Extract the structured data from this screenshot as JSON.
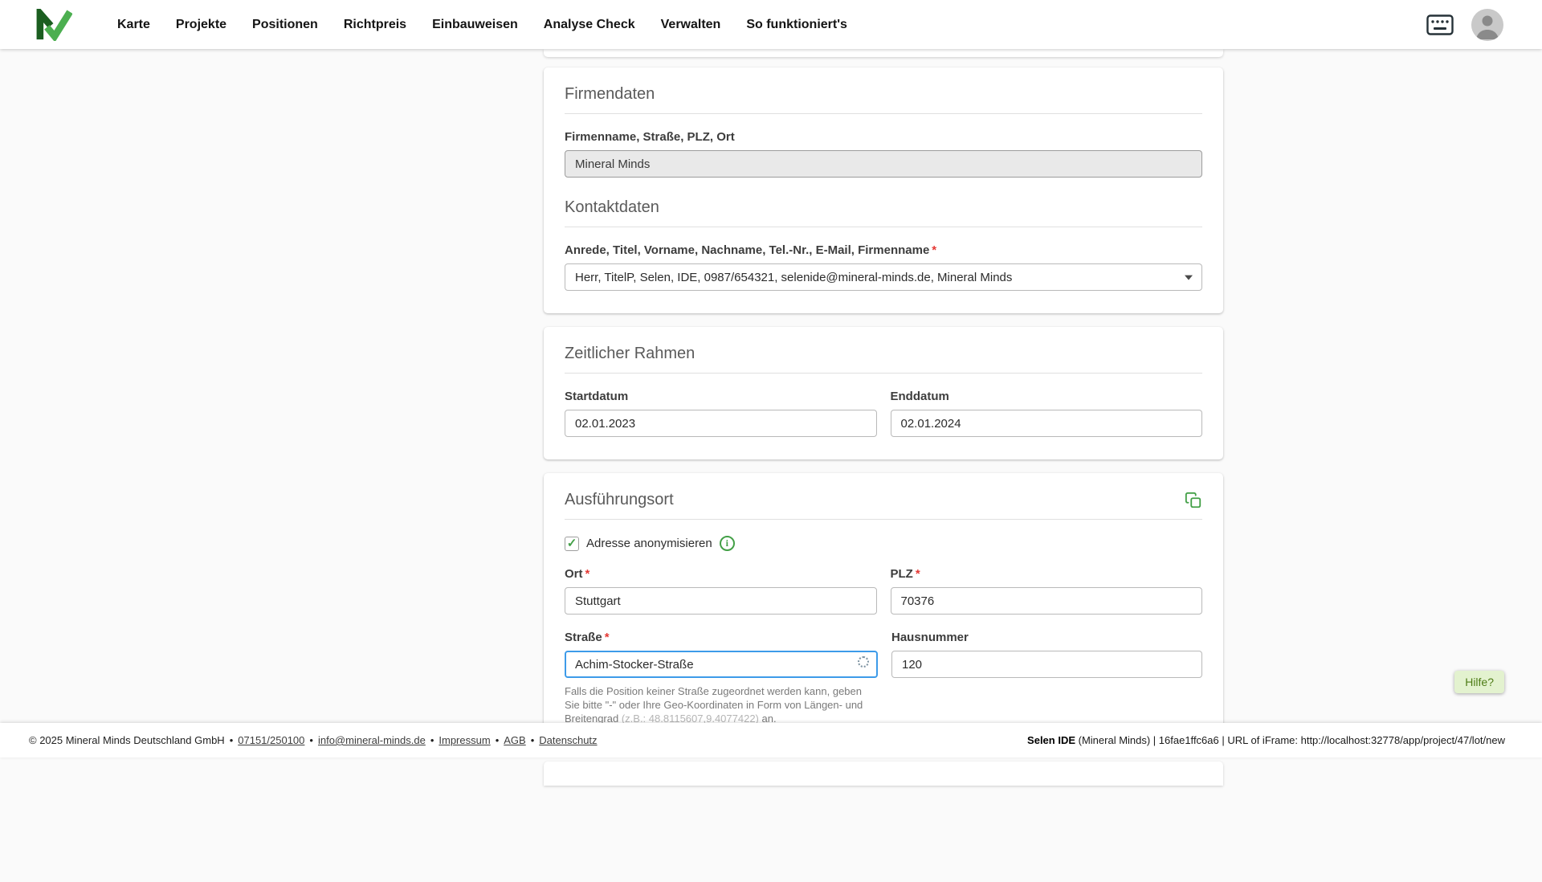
{
  "required_marker": "*",
  "icons": {
    "check_glyph": "✓",
    "info_glyph": "i"
  },
  "colors": {
    "brand_green_dark": "#1b5e20",
    "brand_green_light": "#4caf50",
    "accent_green": "#43a047",
    "focus_blue": "#3d9be9",
    "required_red": "#e53935",
    "help_bg": "#e3f2cf",
    "help_text": "#4e7c16"
  },
  "header": {
    "nav": [
      "Karte",
      "Projekte",
      "Positionen",
      "Richtpreis",
      "Einbauweisen",
      "Analyse Check",
      "Verwalten",
      "So funktioniert's"
    ]
  },
  "cards": {
    "firmendaten": {
      "title": "Firmendaten",
      "firma_label": "Firmenname, Straße, PLZ, Ort",
      "firma_value": "Mineral Minds",
      "kontakt_title": "Kontaktdaten",
      "kontakt_label": "Anrede, Titel, Vorname, Nachname, Tel.-Nr., E-Mail, Firmenname",
      "kontakt_value": "Herr, TitelP, Selen, IDE, 0987/654321, selenide@mineral-minds.de, Mineral Minds"
    },
    "zeitlicher_rahmen": {
      "title": "Zeitlicher Rahmen",
      "startdatum_label": "Startdatum",
      "startdatum_value": "02.01.2023",
      "enddatum_label": "Enddatum",
      "enddatum_value": "02.01.2024"
    },
    "ausfuehrungsort": {
      "title": "Ausführungsort",
      "anonymisieren_label": "Adresse anonymisieren",
      "ort_label": "Ort",
      "ort_value": "Stuttgart",
      "plz_label": "PLZ",
      "plz_value": "70376",
      "strasse_label": "Straße",
      "strasse_value": "Achim-Stocker-Straße",
      "hausnummer_label": "Hausnummer",
      "hausnummer_value": "120",
      "hint_prefix": "Falls die Position keiner Straße zugeordnet werden kann, geben Sie bitte \"-\" oder Ihre Geo-Koordinaten in Form von Längen- und Breitengrad ",
      "hint_example": "(z.B.: 48.8115607,9.4077422)",
      "hint_suffix": " an."
    }
  },
  "help_button": "Hilfe?",
  "footer": {
    "copyright": "© 2025 Mineral Minds Deutschland GmbH",
    "separator": "•",
    "links": [
      "07151/250100",
      "info@mineral-minds.de",
      "Impressum",
      "AGB",
      "Datenschutz"
    ],
    "debug_bold": "Selen IDE",
    "debug_rest": " (Mineral Minds) | 16fae1ffc6a6 | URL of iFrame: http://localhost:32778/app/project/47/lot/new"
  }
}
